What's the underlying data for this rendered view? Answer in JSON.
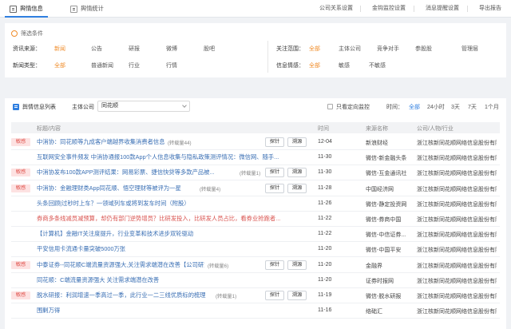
{
  "tabs": [
    {
      "label": "舆情信息",
      "active": true
    },
    {
      "label": "舆情统计",
      "active": false
    }
  ],
  "top_links": [
    "公司关系设置",
    "金钩监控设置",
    "消息提醒设置",
    "导出报告"
  ],
  "filter": {
    "title": "筛选条件",
    "resource": {
      "label": "资讯来源：",
      "options": [
        "新闻",
        "公告",
        "研报",
        "微博",
        "股吧"
      ],
      "selected": "新闻"
    },
    "news_type": {
      "label": "新闻类型：",
      "options": [
        "全部",
        "普通新闻",
        "行业",
        "行情"
      ],
      "selected": "全部"
    },
    "scope": {
      "label": "关注范围：",
      "options": [
        "全部",
        "主体公司",
        "竞争对手",
        "参股股",
        "管理层"
      ],
      "selected": "全部"
    },
    "emotion": {
      "label": "信息情感：",
      "options": [
        "全部",
        "敏感",
        "不敏感"
      ],
      "selected": "全部"
    }
  },
  "list": {
    "title": "舆情信息列表",
    "company_label": "主体公司",
    "company_value": "同花顺",
    "only_label": "只看定向监控",
    "time_label": "时间：",
    "time_options": [
      "全部",
      "24小时",
      "3天",
      "7天",
      "1个月"
    ],
    "time_selected": "全部",
    "columns": [
      "标题/内容",
      "时间",
      "来源名称",
      "公司/人物/行业"
    ],
    "btn_probe": "探针",
    "btn_discredit": "溯源",
    "rows": [
      {
        "badge": "敏感",
        "title": "中消协：同花顺等九成客户端越界收集消费者信息",
        "reprint": "(转载量44)",
        "date": "12-04",
        "source": "新浪财经",
        "org": "浙江核新同花顺网络信息股份有限...",
        "red": false
      },
      {
        "badge": "",
        "title": "互联网安全事件频发 中消协通报100款App个人信息收集与隐私政策测评情况：微信网、随手...",
        "reprint": "",
        "date": "11-30",
        "source": "微信-新金融头条",
        "org": "浙江核新同花顺网络信息股份有限...",
        "red": false
      },
      {
        "badge": "敏感",
        "title": "中消协发布100款APP测评结果：网易彩票、捷信快贷等多款产品被...",
        "reprint": "(转载量1)",
        "date": "11-30",
        "source": "微信-互金通讯社",
        "org": "浙江核新同花顺网络信息股份有限...",
        "red": false
      },
      {
        "badge": "敏感",
        "title": "中消协：金融理财类App同花顺、悟空理财等被评为一星",
        "reprint": "(转载量4)",
        "date": "11-28",
        "source": "中国经济网",
        "org": "浙江核新同花顺网络信息股份有限...",
        "red": false
      },
      {
        "badge": "",
        "title": "头条回顾|过秒时上车？一领域列车或将到发车时间（附股）",
        "reprint": "",
        "date": "11-26",
        "source": "微信-静定投资网",
        "org": "浙江核新同花顺网络信息股份有限...",
        "red": false
      },
      {
        "badge": "",
        "title": "券商多条线减员减预算，却仍有部门逆势增员？比研发投入，比研发人员占比，看券业抢跑者...",
        "reprint": "",
        "date": "11-22",
        "source": "微信-券商中国",
        "org": "浙江核新同花顺网络信息股份有限...",
        "red": true
      },
      {
        "badge": "",
        "title": "【计算机】金融IT关注度提升，行业变革和技术进步双轮驱动",
        "reprint": "",
        "date": "11-22",
        "source": "微信-中信证券...",
        "org": "浙江核新同花顺网络信息股份有限...",
        "red": false
      },
      {
        "badge": "",
        "title": "平安信用卡流通卡量突破5000万张",
        "reprint": "",
        "date": "11-20",
        "source": "微信-中国平安",
        "org": "浙江核新同花顺网络信息股份有限...",
        "red": false
      },
      {
        "badge": "敏感",
        "title": "中泰证券--同花顺C端流量资源强大,关注需求端潜在改善【公司研究】",
        "reprint": "(转载量6)",
        "date": "11-20",
        "source": "金融界",
        "org": "浙江核新同花顺网络信息股份有限...",
        "red": false
      },
      {
        "badge": "",
        "title": "同花顺：C端流量资源强大 关注需求端潜在改善",
        "reprint": "",
        "date": "11-20",
        "source": "证券时报网",
        "org": "浙江核新同花顺网络信息股份有限...",
        "red": false
      },
      {
        "badge": "敏感",
        "title": "脱水研报：利润增速一季高过一季，此行业一二三线优质标的梳理",
        "reprint": "(转载量1)",
        "date": "11-19",
        "source": "微信-脱水研报",
        "org": "浙江核新同花顺网络信息股份有限...",
        "red": false
      },
      {
        "badge": "",
        "title": "围剿万得",
        "reprint": "",
        "date": "11-16",
        "source": "络础汇",
        "org": "浙江核新同花顺网络信息股份有限...",
        "red": false
      }
    ],
    "row_buttons": [
      true,
      false,
      true,
      true,
      false,
      false,
      false,
      false,
      true,
      false,
      true,
      false
    ]
  },
  "colors": {
    "accent": "#2f7fe0",
    "selected_orange": "#f08c2a",
    "sensitive_red": "#e0554f",
    "link_blue": "#3a6fb4"
  }
}
